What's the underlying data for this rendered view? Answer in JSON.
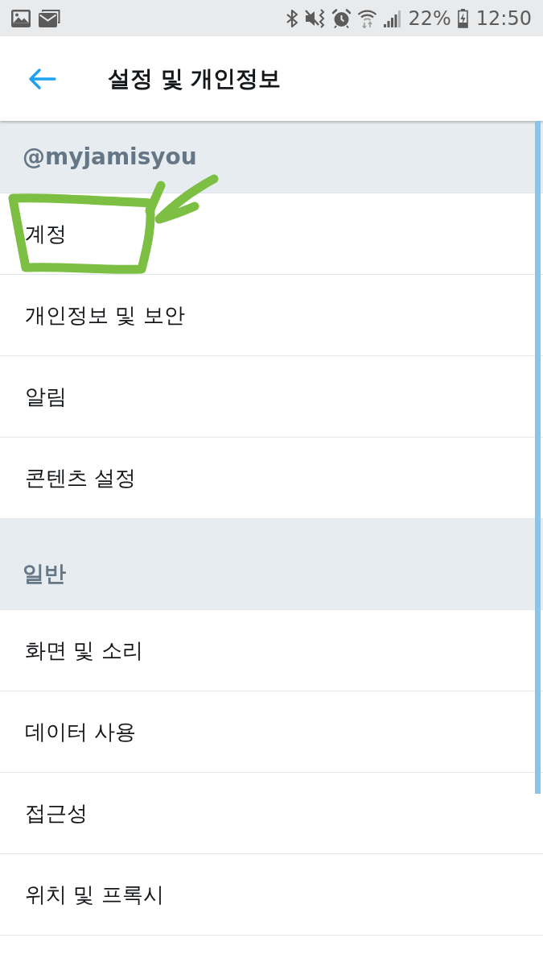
{
  "status_bar": {
    "battery": "22%",
    "time": "12:50"
  },
  "header": {
    "title": "설정 및 개인정보"
  },
  "sections": [
    {
      "title": "@myjamisyou",
      "items": [
        {
          "label": "계정"
        },
        {
          "label": "개인정보 및 보안"
        },
        {
          "label": "알림"
        },
        {
          "label": "콘텐츠 설정"
        }
      ]
    },
    {
      "title": "일반",
      "items": [
        {
          "label": "화면 및 소리"
        },
        {
          "label": "데이터 사용"
        },
        {
          "label": "접근성"
        },
        {
          "label": "위치 및 프록시"
        }
      ]
    }
  ]
}
